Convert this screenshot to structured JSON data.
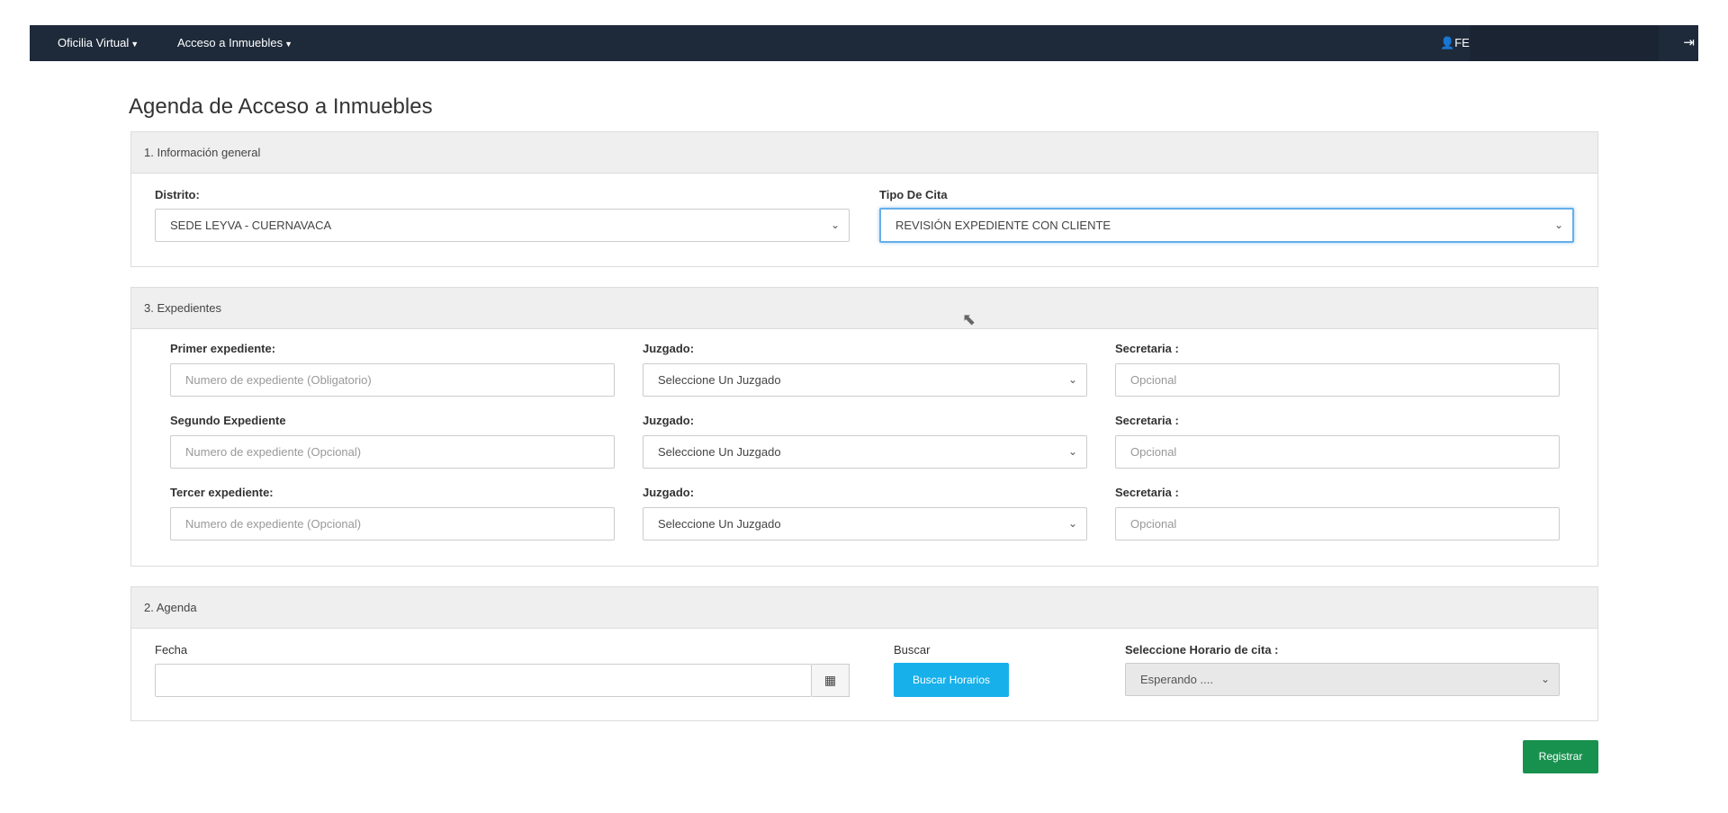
{
  "navbar": {
    "item1": "Oficilia Virtual",
    "item2": "Acceso a Inmuebles",
    "user_label": "FE"
  },
  "page": {
    "title": "Agenda de Acceso a Inmuebles"
  },
  "general": {
    "heading": "1. Información general",
    "distrito_label": "Distrito:",
    "distrito_value": "SEDE LEYVA - CUERNAVACA",
    "tipo_label": "Tipo De Cita",
    "tipo_value": "REVISIÓN EXPEDIENTE CON CLIENTE"
  },
  "expedientes": {
    "heading": "3. Expedientes",
    "rows": [
      {
        "exp_label": "Primer expediente:",
        "exp_placeholder": "Numero de expediente (Obligatorio)",
        "juz_label": "Juzgado:",
        "juz_value": "Seleccione Un Juzgado",
        "sec_label": "Secretaria :",
        "sec_placeholder": "Opcional"
      },
      {
        "exp_label": "Segundo Expediente",
        "exp_placeholder": "Numero de expediente (Opcional)",
        "juz_label": "Juzgado:",
        "juz_value": "Seleccione Un Juzgado",
        "sec_label": "Secretaria :",
        "sec_placeholder": "Opcional"
      },
      {
        "exp_label": "Tercer expediente:",
        "exp_placeholder": "Numero de expediente (Opcional)",
        "juz_label": "Juzgado:",
        "juz_value": "Seleccione Un Juzgado",
        "sec_label": "Secretaria :",
        "sec_placeholder": "Opcional"
      }
    ]
  },
  "agenda": {
    "heading": "2. Agenda",
    "fecha_label": "Fecha",
    "fecha_value": "",
    "buscar_label": "Buscar",
    "buscar_button": "Buscar Horarios",
    "horario_label": "Seleccione Horario de cita :",
    "horario_value": "Esperando ...."
  },
  "footer": {
    "registrar_button": "Registrar"
  }
}
